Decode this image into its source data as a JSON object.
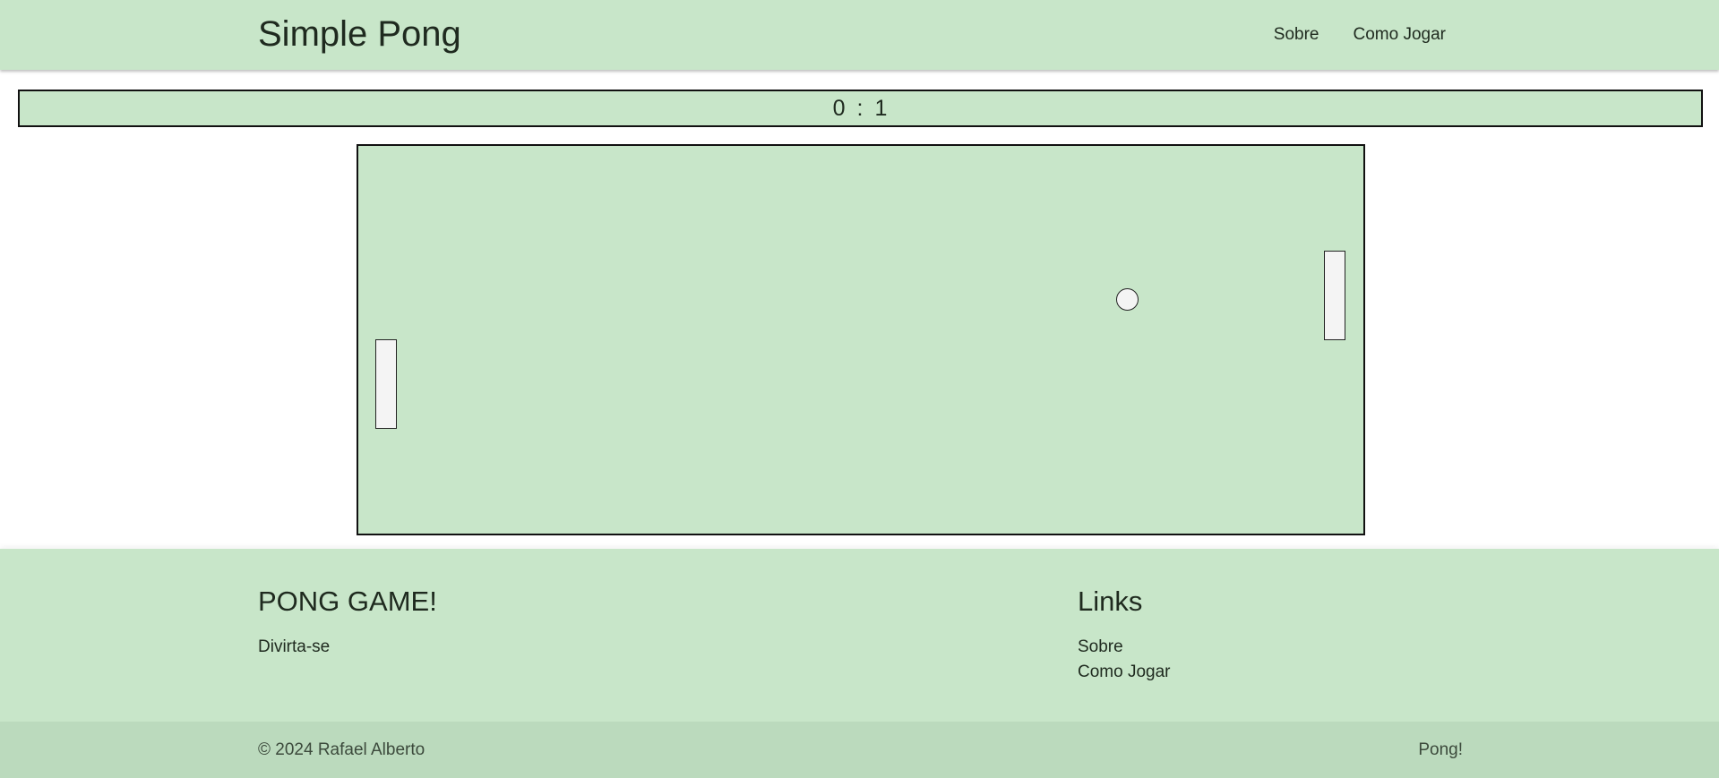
{
  "header": {
    "brand": "Simple Pong",
    "nav": [
      {
        "label": "Sobre"
      },
      {
        "label": "Como Jogar"
      }
    ]
  },
  "scoreboard": {
    "left_score": "0",
    "separator": ":",
    "right_score": "1"
  },
  "game": {
    "colors": {
      "field": "#c8e6c9",
      "paddle": "#f4f4f4",
      "ball": "#f4f4f4"
    }
  },
  "footer": {
    "title": "PONG GAME!",
    "text": "Divirta-se",
    "links_title": "Links",
    "links": [
      {
        "label": "Sobre"
      },
      {
        "label": "Como Jogar"
      }
    ]
  },
  "copyright": {
    "text": "© 2024 Rafael Alberto",
    "right_link": "Pong!"
  },
  "colors": {
    "accent": "#c8e6c9",
    "footer_bottom": "#bbdabd"
  }
}
